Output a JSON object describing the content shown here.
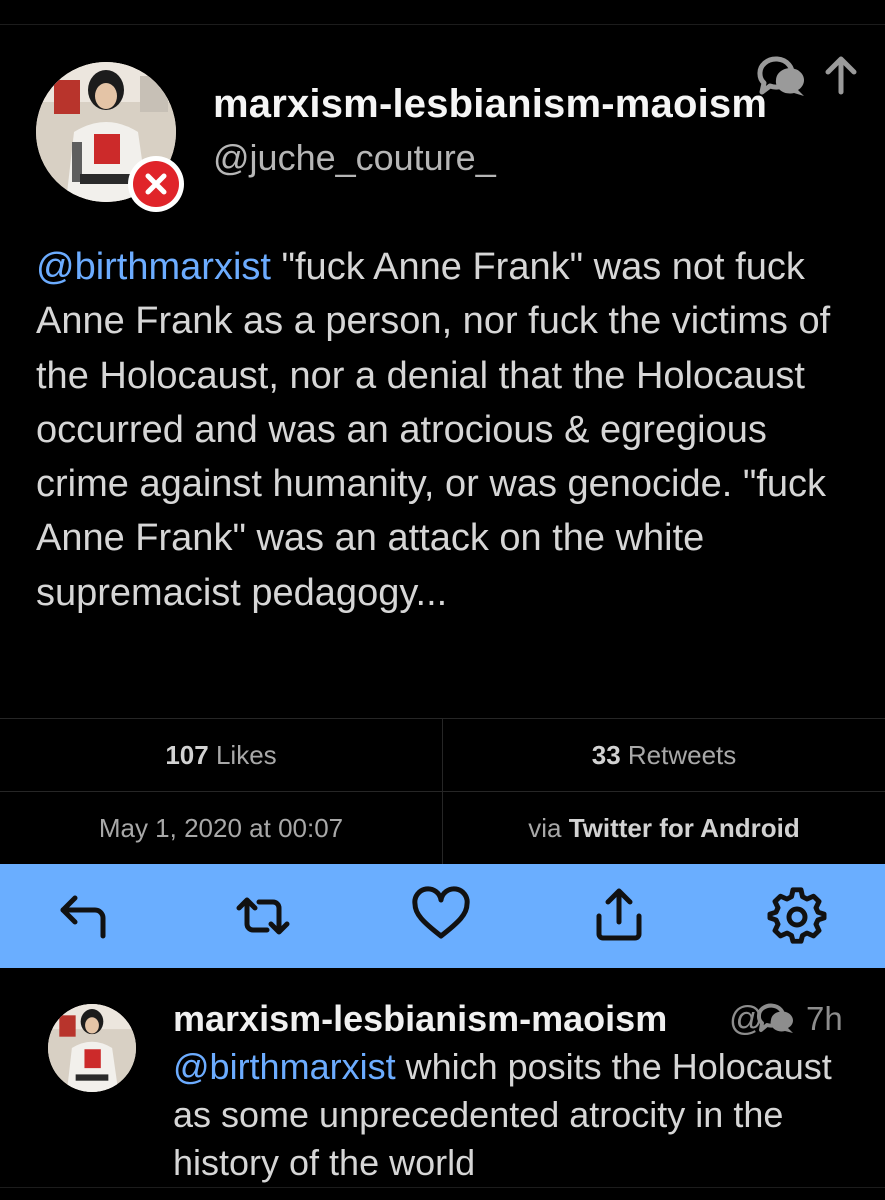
{
  "tweet": {
    "author": {
      "display_name": "marxism-lesbianism-maoism",
      "handle": "@juche_couture_"
    },
    "mention": "@birthmarxist",
    "text": " \"fuck Anne Frank\" was not fuck Anne Frank as a person, nor fuck the victims of the Holocaust, nor a denial that the Holocaust occurred and was an atrocious & egregious crime against humanity, or was genocide. \"fuck Anne Frank\" was an attack on the white supremacist pedagogy...",
    "likes_count": "107",
    "likes_label": " Likes",
    "retweets_count": "33",
    "retweets_label": " Retweets",
    "timestamp": "May 1, 2020 at 00:07",
    "via_prefix": "via ",
    "source": "Twitter for Android"
  },
  "actions": [
    {
      "name": "reply",
      "icon": "reply-icon"
    },
    {
      "name": "retweet",
      "icon": "retweet-icon"
    },
    {
      "name": "like",
      "icon": "heart-icon"
    },
    {
      "name": "share",
      "icon": "share-icon"
    },
    {
      "name": "settings",
      "icon": "gear-icon"
    }
  ],
  "reply": {
    "display_name": "marxism-lesbianism-maoism",
    "handle_fragment": "@",
    "time": "7h",
    "mention": "@birthmarxist",
    "text": " which posits the Holocaust as some unprecedented atrocity in the history of the world"
  },
  "colors": {
    "accent": "#6aaeff",
    "mention": "#6cacff",
    "badge": "#e0242a"
  }
}
